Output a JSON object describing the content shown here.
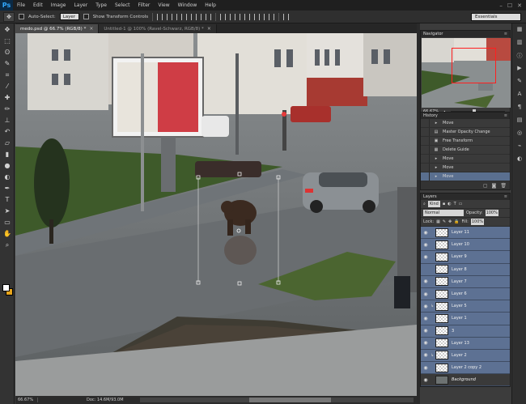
{
  "app": {
    "logo": "Ps"
  },
  "menu": [
    "File",
    "Edit",
    "Image",
    "Layer",
    "Type",
    "Select",
    "Filter",
    "View",
    "Window",
    "Help"
  ],
  "window_controls": [
    "–",
    "☐",
    "✕"
  ],
  "options": {
    "auto_select_label": "Auto-Select:",
    "auto_select_value": "Layer",
    "show_transform_label": "Show Transform Controls",
    "workspace": "Essentials"
  },
  "tabs": [
    {
      "label": "medo.psd @ 66.7% (RGB/8) *",
      "close": "×"
    },
    {
      "label": "Untitled-1 @ 100% (Ravel-Schwarz, RGB/8) *",
      "close": "×"
    }
  ],
  "status": {
    "zoom": "66.67%",
    "doc": "Doc: 14.6M/93.0M"
  },
  "navigator": {
    "title": "Navigator",
    "zoom": "66.67%"
  },
  "history": {
    "title": "History",
    "items": [
      {
        "label": "Move",
        "icon": "move-icon"
      },
      {
        "label": "Master Opacity Change",
        "icon": "opacity-icon"
      },
      {
        "label": "Free Transform",
        "icon": "transform-icon"
      },
      {
        "label": "Delete Guide",
        "icon": "guide-icon"
      },
      {
        "label": "Move",
        "icon": "move-icon"
      },
      {
        "label": "Move",
        "icon": "move-icon"
      },
      {
        "label": "Move",
        "icon": "move-icon",
        "selected": true
      }
    ]
  },
  "layers": {
    "title": "Layers",
    "kind": "Kind",
    "blend": "Normal",
    "opacity_label": "Opacity:",
    "opacity": "100%",
    "lock_label": "Lock:",
    "fill_label": "Fill:",
    "fill": "100%",
    "items": [
      {
        "name": "Layer 11",
        "selected": true
      },
      {
        "name": "Layer 10",
        "selected": true
      },
      {
        "name": "Layer 9",
        "selected": true
      },
      {
        "name": "Layer 8",
        "selected": true
      },
      {
        "name": "Layer 7",
        "selected": true
      },
      {
        "name": "Layer 6",
        "selected": true
      },
      {
        "name": "Layer 5",
        "selected": true,
        "linked": true
      },
      {
        "name": "Layer 1",
        "selected": true
      },
      {
        "name": "3",
        "selected": true
      },
      {
        "name": "Layer 13",
        "selected": true
      },
      {
        "name": "Layer 2",
        "selected": true,
        "linked": true
      },
      {
        "name": "Layer 2 copy 2",
        "selected": true
      },
      {
        "name": "Background",
        "selected": false,
        "photo": true
      }
    ]
  },
  "colors": {
    "foreground": "#ffffff",
    "background": "#e8a51c",
    "selection": "#5d7193",
    "nav_view": "#ff1f1f"
  }
}
